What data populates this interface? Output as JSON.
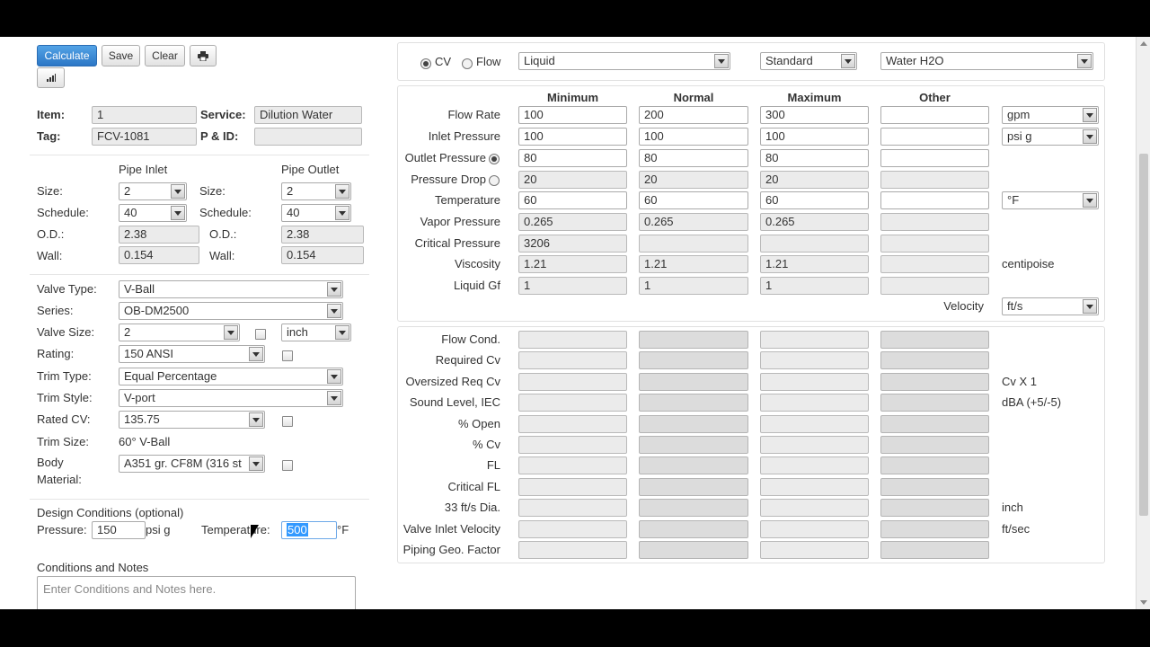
{
  "toolbar": {
    "calculate": "Calculate",
    "save": "Save",
    "clear": "Clear"
  },
  "info": {
    "item_label": "Item:",
    "item_value": "1",
    "service_label": "Service:",
    "service_value": "Dilution Water",
    "tag_label": "Tag:",
    "tag_value": "FCV-1081",
    "pid_label": "P & ID:",
    "pid_value": ""
  },
  "pipe": {
    "inlet_header": "Pipe Inlet",
    "outlet_header": "Pipe Outlet",
    "size_label": "Size:",
    "schedule_label": "Schedule:",
    "od_label": "O.D.:",
    "wall_label": "Wall:",
    "inlet": {
      "size": "2",
      "schedule": "40",
      "od": "2.38",
      "wall": "0.154"
    },
    "outlet": {
      "size": "2",
      "schedule": "40",
      "od": "2.38",
      "wall": "0.154"
    }
  },
  "valve": {
    "type_label": "Valve Type:",
    "type": "V-Ball",
    "series_label": "Series:",
    "series": "OB-DM2500",
    "size_label": "Valve Size:",
    "size": "2",
    "size_unit": "inch",
    "rating_label": "Rating:",
    "rating": "150 ANSI",
    "trim_type_label": "Trim Type:",
    "trim_type": "Equal Percentage",
    "trim_style_label": "Trim Style:",
    "trim_style": "V-port",
    "rated_cv_label": "Rated CV:",
    "rated_cv": "135.75",
    "trim_size_label": "Trim Size:",
    "trim_size": "60° V-Ball",
    "body_label_1": "Body",
    "body_label_2": "Material:",
    "body_material": "A351 gr. CF8M (316 st"
  },
  "design": {
    "header": "Design Conditions (optional)",
    "pressure_label": "Pressure:",
    "pressure": "150",
    "pressure_unit": "psi g",
    "temp_label": "Temperature:",
    "temp": "500",
    "temp_unit": "°F"
  },
  "notes": {
    "header": "Conditions and Notes",
    "placeholder": "Enter Conditions and Notes here."
  },
  "mode": {
    "cv_label": "CV",
    "flow_label": "Flow",
    "fluid_type": "Liquid",
    "standard": "Standard",
    "fluid": "Water H2O"
  },
  "columns": [
    "Minimum",
    "Normal",
    "Maximum",
    "Other"
  ],
  "inputs": [
    {
      "label": "Flow Rate",
      "values": [
        "100",
        "200",
        "300",
        ""
      ],
      "unit": "gpm",
      "unit_select": true
    },
    {
      "label": "Inlet Pressure",
      "values": [
        "100",
        "100",
        "100",
        ""
      ],
      "unit": "psi g",
      "unit_select": true
    },
    {
      "label": "Outlet Pressure",
      "values": [
        "80",
        "80",
        "80",
        ""
      ],
      "unit": "",
      "unit_select": false
    },
    {
      "label": "Pressure Drop",
      "values": [
        "20",
        "20",
        "20",
        ""
      ],
      "unit": "",
      "unit_select": false
    },
    {
      "label": "Temperature",
      "values": [
        "60",
        "60",
        "60",
        ""
      ],
      "unit": "°F",
      "unit_select": true
    },
    {
      "label": "Vapor Pressure",
      "values": [
        "0.265",
        "0.265",
        "0.265",
        ""
      ],
      "unit": "",
      "unit_select": false
    },
    {
      "label": "Critical Pressure",
      "values": [
        "3206",
        "",
        "",
        ""
      ],
      "unit": "",
      "unit_select": false
    },
    {
      "label": "Viscosity",
      "values": [
        "1.21",
        "1.21",
        "1.21",
        ""
      ],
      "unit": "centipoise",
      "unit_select": false
    },
    {
      "label": "Liquid Gf",
      "values": [
        "1",
        "1",
        "1",
        ""
      ],
      "unit": "",
      "unit_select": false
    }
  ],
  "velocity": {
    "label": "Velocity",
    "unit": "ft/s"
  },
  "results": [
    {
      "label": "Flow Cond.",
      "unit": ""
    },
    {
      "label": "Required Cv",
      "unit": ""
    },
    {
      "label": "Oversized Req Cv",
      "unit": "Cv X 1"
    },
    {
      "label": "Sound Level, IEC",
      "unit": "dBA (+5/-5)"
    },
    {
      "label": "% Open",
      "unit": ""
    },
    {
      "label": "% Cv",
      "unit": ""
    },
    {
      "label": "FL",
      "unit": ""
    },
    {
      "label": "Critical FL",
      "unit": ""
    },
    {
      "label": "33 ft/s Dia.",
      "unit": "inch"
    },
    {
      "label": "Valve Inlet Velocity",
      "unit": "ft/sec"
    },
    {
      "label": "Piping Geo. Factor",
      "unit": ""
    }
  ]
}
